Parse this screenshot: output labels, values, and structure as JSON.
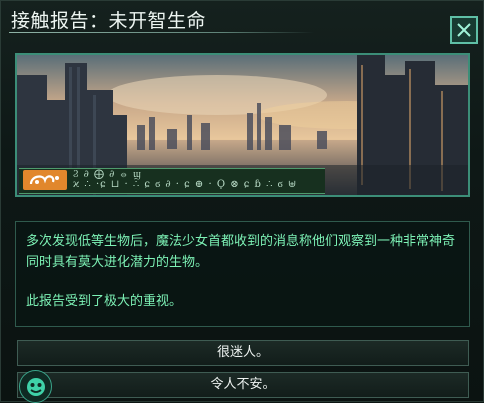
{
  "dialog": {
    "title": "接触报告：未开智生命",
    "close_icon": "close-x-icon"
  },
  "image": {
    "caption_line1": "Ϩ ∂ ⨁ ∂ ⦵ ϣ",
    "caption_line2": "ϰ ∴ ·ɕ ⊔ · ∴ ɕ ϭ ∂ · ɕ ⊕ · Ϙ ⊗ ɕ ɓ ∴ ϭ ⊎"
  },
  "body": {
    "paragraph1": "多次发现低等生物后，魔法少女首都收到的消息称他们观察到一种非常神奇同时具有莫大进化潜力的生物。",
    "paragraph2": "此报告受到了极大的重视。"
  },
  "options": [
    {
      "label": "很迷人。"
    },
    {
      "label": "令人不安。",
      "icon": "species-emblem-icon"
    }
  ],
  "colors": {
    "accent": "#3c8e78",
    "text_green": "#7df2b6",
    "banner_orange": "#e1872c"
  }
}
